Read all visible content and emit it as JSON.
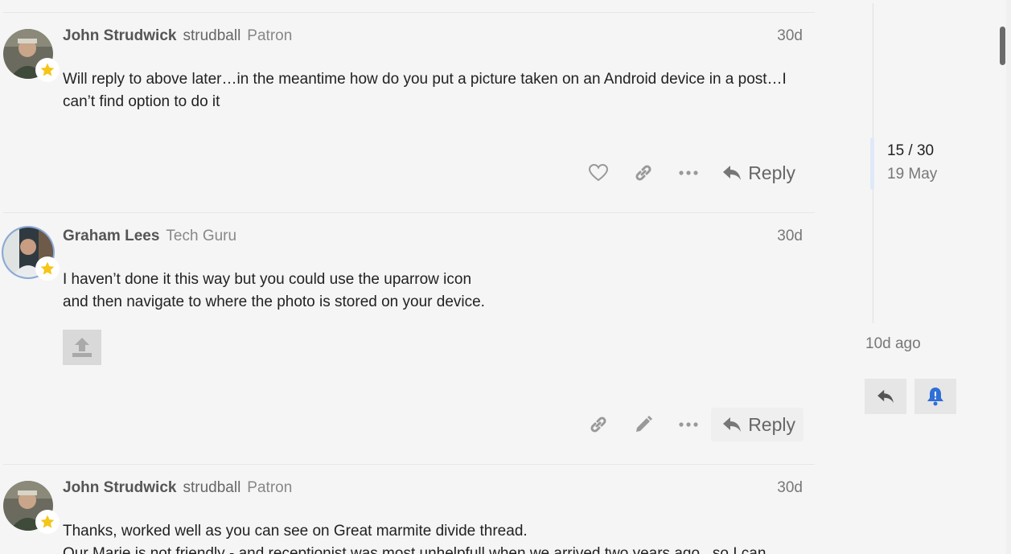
{
  "posts": [
    {
      "name": "John Strudwick",
      "username": "strudball",
      "title": "Patron",
      "date": "30d",
      "lines": [
        "Will reply to above later…in the meantime how do you put a picture taken on an Android device in a post…I",
        "can’t find option to do it"
      ],
      "reply_label": "Reply",
      "avatar_icon": "user-avatar",
      "badge_icon": "star-icon"
    },
    {
      "name": "Graham Lees",
      "title": "Tech Guru",
      "date": "30d",
      "lines": [
        "I haven’t done it this way but you could use the uparrow icon",
        "and then navigate to where the photo is stored on your device."
      ],
      "image_icon": "upload-icon",
      "reply_label": "Reply",
      "avatar_icon": "user-avatar",
      "badge_icon": "star-icon"
    },
    {
      "name": "John Strudwick",
      "username": "strudball",
      "title": "Patron",
      "date": "30d",
      "lines": [
        "Thanks, worked well as you can see on Great marmite divide thread.",
        "Our Marie is not friendly - and receptionist was most unhelpfull when we arrived two years ago , so I can"
      ],
      "avatar_icon": "user-avatar",
      "badge_icon": "star-icon"
    }
  ],
  "timeline": {
    "position": "15 / 30",
    "date": "19 May",
    "last_activity": "10d ago",
    "reply_icon": "reply-icon",
    "notification_icon": "bell-alert-icon"
  },
  "colors": {
    "background": "#f5f5f5",
    "star": "#f5c518",
    "bell": "#2f6fd6",
    "muted": "#777777"
  }
}
